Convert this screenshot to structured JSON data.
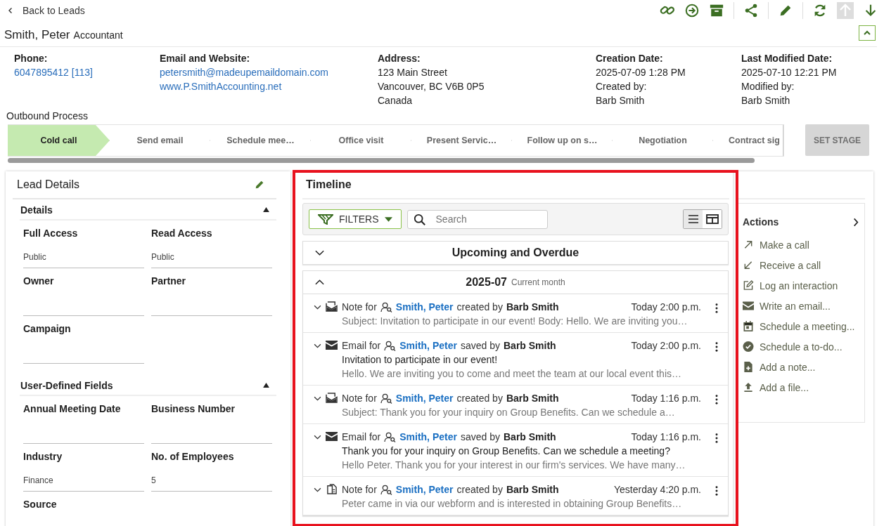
{
  "nav": {
    "back": "Back to Leads"
  },
  "lead": {
    "name": "Smith, Peter",
    "title": "Accountant",
    "expanded": true
  },
  "info": [
    {
      "label": "Phone:",
      "lines": [
        {
          "text": "6047895412 [113]",
          "link": true
        }
      ]
    },
    {
      "label": "Email and Website:",
      "lines": [
        {
          "text": "petersmith@madeupemaildomain.com",
          "link": true
        },
        {
          "text": "www.P.SmithAccounting.net",
          "link": true
        }
      ]
    },
    {
      "label": "Address:",
      "lines": [
        {
          "text": "123 Main Street",
          "link": false
        },
        {
          "text": "Vancouver, BC V6B 0P5",
          "link": false
        },
        {
          "text": "Canada",
          "link": false
        }
      ]
    },
    {
      "label": "Creation Date:",
      "lines": [
        {
          "text": "2025-07-09 1:28 PM",
          "link": false
        },
        {
          "text": "Created by:",
          "link": false
        },
        {
          "text": "Barb Smith",
          "link": false
        }
      ]
    },
    {
      "label": "Last Modified Date:",
      "lines": [
        {
          "text": "2025-07-10 12:21 PM",
          "link": false
        },
        {
          "text": "Modified by:",
          "link": false
        },
        {
          "text": "Barb Smith",
          "link": false
        }
      ]
    }
  ],
  "process": {
    "title": "Outbound Process",
    "stages": [
      {
        "label": "Cold call",
        "selected": true
      },
      {
        "label": "Send email",
        "selected": false
      },
      {
        "label": "Schedule mee…",
        "selected": false
      },
      {
        "label": "Office visit",
        "selected": false
      },
      {
        "label": "Present Servic…",
        "selected": false
      },
      {
        "label": "Follow up on s…",
        "selected": false
      },
      {
        "label": "Negotiation",
        "selected": false
      },
      {
        "label": "Contract sig",
        "selected": false
      }
    ],
    "set_stage": {
      "label": "SET STAGE",
      "disabled": true
    }
  },
  "lead_details": {
    "title": "Lead Details",
    "sections": [
      {
        "title": "Details",
        "expanded": true,
        "fields": [
          {
            "label": "Full Access",
            "value": "Public"
          },
          {
            "label": "Read Access",
            "value": "Public"
          },
          {
            "label": "Owner"
          },
          {
            "label": "Partner"
          },
          {
            "label": "Campaign"
          }
        ]
      },
      {
        "title": "User-Defined Fields",
        "expanded": true,
        "fields": [
          {
            "label": "Annual Meeting Date"
          },
          {
            "label": "Business Number"
          },
          {
            "label": "Industry",
            "value": "Finance"
          },
          {
            "label": "No. of Employees",
            "value": "5"
          },
          {
            "label": "Source"
          }
        ]
      }
    ]
  },
  "timeline": {
    "title": "Timeline",
    "filters": "FILTERS",
    "search": {
      "placeholder": "Search"
    },
    "views": [
      {
        "kind": "list",
        "selected": true
      },
      {
        "kind": "table",
        "selected": false
      }
    ],
    "groups": [
      {
        "title": "Upcoming and Overdue",
        "expanded": false
      },
      {
        "title": "2025-07",
        "subtitle": "Current month",
        "expanded": true
      }
    ],
    "items": [
      {
        "kind": "note_mail",
        "prefix": "Note for",
        "contact": "Smith, Peter",
        "verb": "created by",
        "author": "Barb Smith",
        "time": "Today 2:00 p.m.",
        "preview": "Subject: Invitation to participate in our event! Body: Hello. We are inviting you…"
      },
      {
        "kind": "email",
        "prefix": "Email for",
        "contact": "Smith, Peter",
        "verb": "saved by",
        "author": "Barb Smith",
        "time": "Today 2:00 p.m.",
        "subject": "Invitation to participate in our event!",
        "preview": "Hello. We are inviting you to come and meet the team at our local event this…"
      },
      {
        "kind": "note_mail",
        "prefix": "Note for",
        "contact": "Smith, Peter",
        "verb": "created by",
        "author": "Barb Smith",
        "time": "Today 1:16 p.m.",
        "preview": "Subject: Thank you for your inquiry on Group Benefits. Can we schedule a…"
      },
      {
        "kind": "email",
        "prefix": "Email for",
        "contact": "Smith, Peter",
        "verb": "saved by",
        "author": "Barb Smith",
        "time": "Today 1:16 p.m.",
        "subject": "Thank you for your inquiry on Group Benefits. Can we schedule a meeting?",
        "preview": "Hello Peter. Thank you for your interest in our firm's services. We have many…"
      },
      {
        "kind": "note_doc",
        "prefix": "Note for",
        "contact": "Smith, Peter",
        "verb": "created by",
        "author": "Barb Smith",
        "time": "Yesterday 4:20 p.m.",
        "preview": "Peter came in via our webform and is interested in obtaining Group Benefits…"
      }
    ]
  },
  "actions": {
    "title": "Actions",
    "items": [
      {
        "kind": "make_call",
        "label": "Make a call"
      },
      {
        "kind": "receive_call",
        "label": "Receive a call"
      },
      {
        "kind": "log",
        "label": "Log an interaction"
      },
      {
        "kind": "email",
        "label": "Write an email..."
      },
      {
        "kind": "meeting",
        "label": "Schedule a meeting..."
      },
      {
        "kind": "todo",
        "label": "Schedule a to-do..."
      },
      {
        "kind": "note",
        "label": "Add a note..."
      },
      {
        "kind": "file",
        "label": "Add a file..."
      }
    ]
  }
}
